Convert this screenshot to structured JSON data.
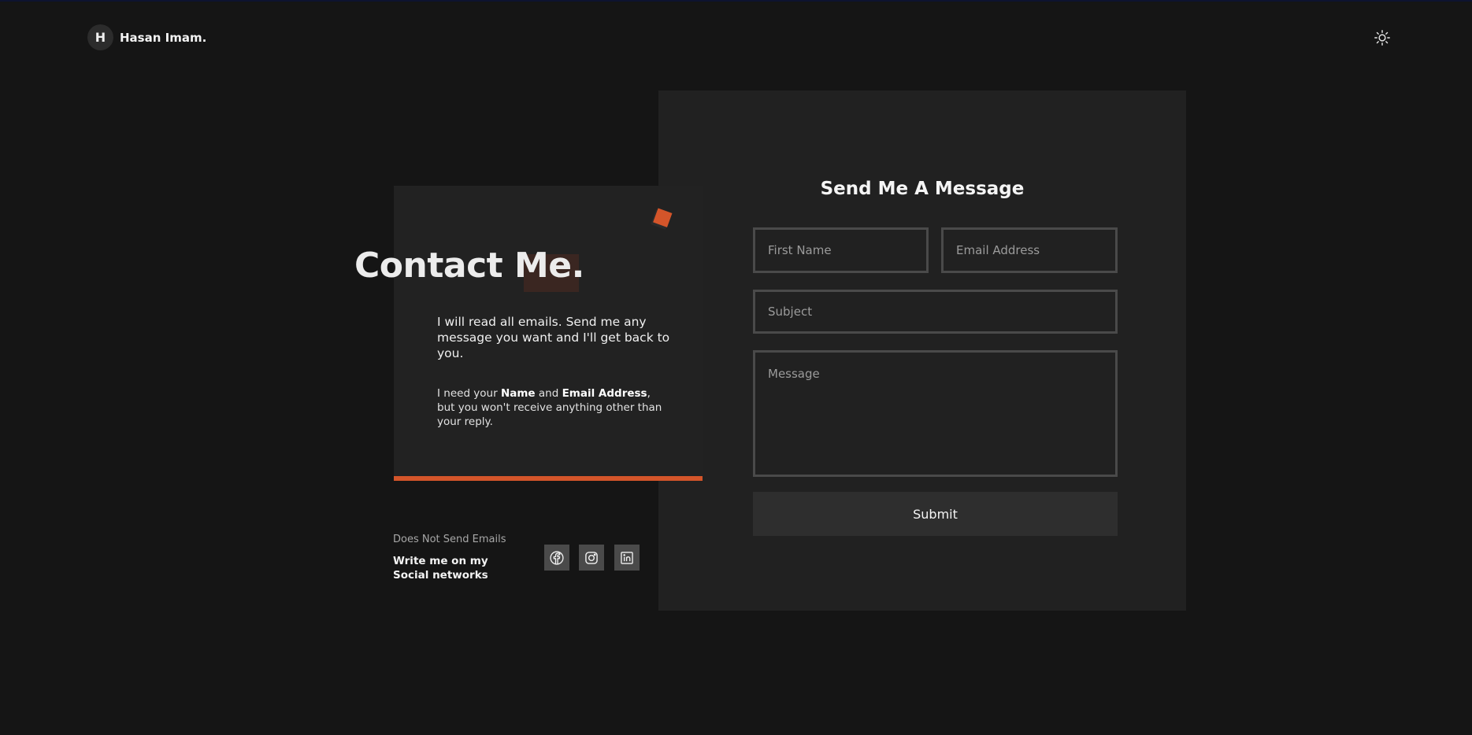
{
  "header": {
    "avatar_letter": "H",
    "brand_name": "Hasan Imam.",
    "theme_icon": "sun-icon"
  },
  "contact": {
    "title": "Contact Me.",
    "lead": "I will read all emails. Send me any message you want and I'll get back to you.",
    "note": {
      "prefix": "I need your ",
      "name": "Name",
      "and": " and ",
      "email": "Email Address",
      "suffix": ", but you won't receive anything other than your reply."
    },
    "accent_color": "#d4552a"
  },
  "social": {
    "caption": "Does Not Send Emails",
    "heading": "Write me on my Social networks",
    "icons": [
      "facebook-icon",
      "instagram-icon",
      "linkedin-icon"
    ]
  },
  "form": {
    "title": "Send Me A Message",
    "first_name_placeholder": "First Name",
    "email_placeholder": "Email Address",
    "subject_placeholder": "Subject",
    "message_placeholder": "Message",
    "submit_label": "Submit"
  }
}
